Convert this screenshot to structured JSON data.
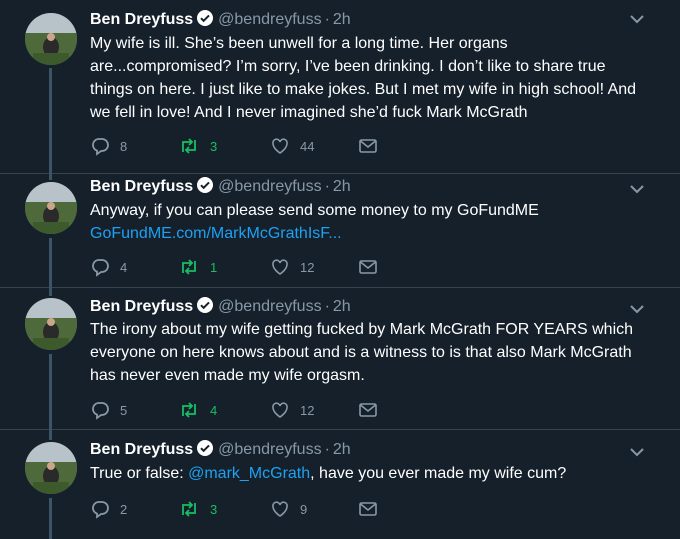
{
  "colors": {
    "background": "#15202b",
    "link": "#1da1f2",
    "retweet": "#17bf63",
    "muted": "#8899a6"
  },
  "icons": {
    "reply": "reply-icon",
    "retweet": "retweet-icon",
    "like": "heart-icon",
    "dm": "envelope-icon",
    "verified": "verified-badge-icon",
    "menu": "chevron-down-icon"
  },
  "tweets": [
    {
      "name": "Ben Dreyfuss",
      "handle": "@bendreyfuss",
      "dot": "·",
      "time": "2h",
      "text": "My wife is ill. She’s been unwell for a long time. Her organs are...compromised? I’m sorry, I’ve been drinking. I don’t like to share true things on here. I just like to make jokes. But I met my wife in high school! And we fell in love! And I never imagined she’d fuck Mark McGrath",
      "replies": "8",
      "retweets": "3",
      "likes": "44"
    },
    {
      "name": "Ben Dreyfuss",
      "handle": "@bendreyfuss",
      "dot": "·",
      "time": "2h",
      "text": "Anyway, if you can please send some money to my GoFundME",
      "link": "GoFundME.com/MarkMcGrathIsF...",
      "replies": "4",
      "retweets": "1",
      "likes": "12"
    },
    {
      "name": "Ben Dreyfuss",
      "handle": "@bendreyfuss",
      "dot": "·",
      "time": "2h",
      "text": "The irony about my wife getting fucked by Mark McGrath FOR YEARS which everyone on here knows about and is a witness to is that also Mark McGrath has never even made my wife orgasm.",
      "replies": "5",
      "retweets": "4",
      "likes": "12"
    },
    {
      "name": "Ben Dreyfuss",
      "handle": "@bendreyfuss",
      "dot": "·",
      "time": "2h",
      "text_before": "True or false: ",
      "mention": "@mark_McGrath",
      "text_after": ", have you ever made my wife cum?",
      "replies": "2",
      "retweets": "3",
      "likes": "9"
    }
  ]
}
